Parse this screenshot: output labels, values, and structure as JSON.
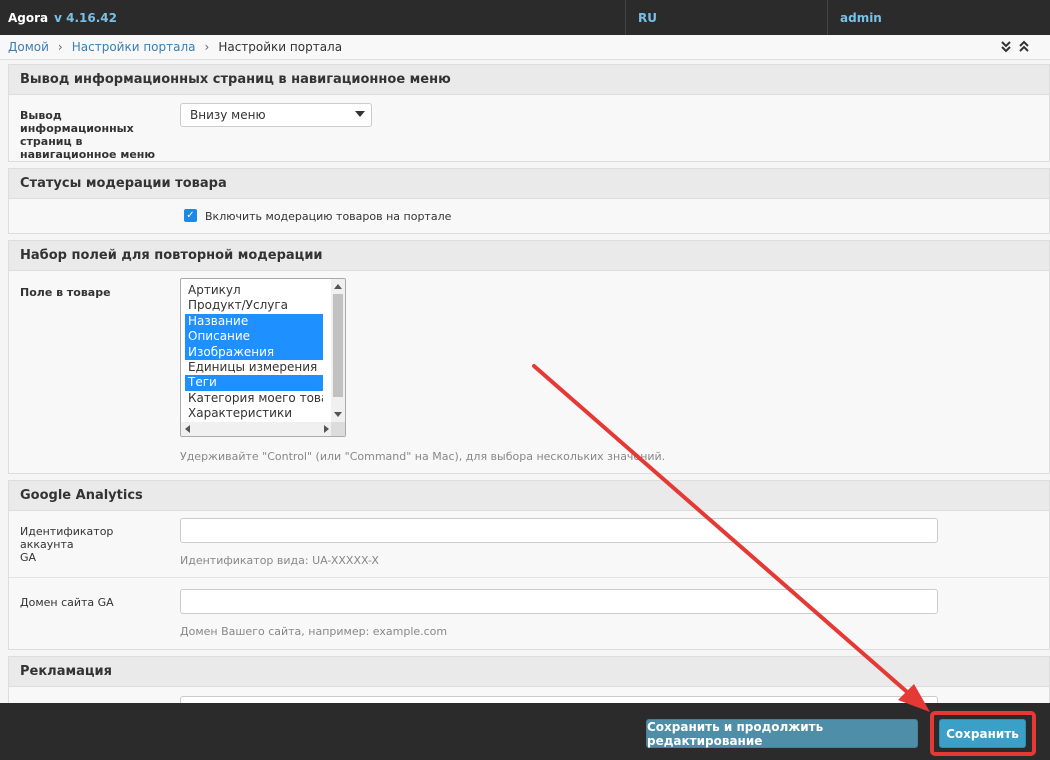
{
  "app": {
    "name": "Agora",
    "version": "v 4.16.42",
    "language": "RU",
    "user": "admin"
  },
  "breadcrumbs": {
    "home": "Домой",
    "parent": "Настройки портала",
    "current": "Настройки портала"
  },
  "sections": {
    "nav_menu": {
      "title": "Вывод информационных страниц в навигационное меню",
      "label": "Вывод информационных страниц в навигационное меню",
      "label_lines": [
        "Вывод информационных",
        "страниц в",
        "навигационное меню"
      ],
      "value": "Внизу меню"
    },
    "moderation": {
      "title": "Статусы модерации товара",
      "checkbox_label": "Включить модерацию товаров на портале",
      "checked": true
    },
    "remoderation": {
      "title": "Набор полей для повторной модерации",
      "label": "Поле в товаре",
      "options": [
        {
          "text": "Артикул",
          "selected": false
        },
        {
          "text": "Продукт/Услуга",
          "selected": false
        },
        {
          "text": "Название",
          "selected": true
        },
        {
          "text": "Описание",
          "selected": true
        },
        {
          "text": "Изображения",
          "selected": true
        },
        {
          "text": "Единицы измерения",
          "selected": false
        },
        {
          "text": "Теги",
          "selected": true
        },
        {
          "text": "Категория моего товара",
          "selected": false
        },
        {
          "text": "Характеристики",
          "selected": false
        }
      ],
      "help": "Удерживайте \"Control\" (или \"Command\" на Mac), для выбора нескольких значений."
    },
    "analytics": {
      "title": "Google Analytics",
      "account_label": "Идентификатор аккаунта GA",
      "account_label_lines": [
        "Идентификатор аккаунта",
        "GA"
      ],
      "account_value": "",
      "account_help": "Идентификатор вида: UA-XXXXX-X",
      "domain_label": "Домен сайта GA",
      "domain_value": "",
      "domain_help": "Домен Вашего сайта, например: example.com"
    },
    "ads": {
      "title": "Рекламация"
    }
  },
  "footer": {
    "save_continue_label": "Сохранить и продолжить редактирование",
    "save_label": "Сохранить"
  },
  "colors": {
    "topbar": "#2b2b2b",
    "link": "#3b7fb3",
    "accent": "#3aa0c7",
    "selection": "#1e90ff",
    "annotation": "#e53935"
  }
}
